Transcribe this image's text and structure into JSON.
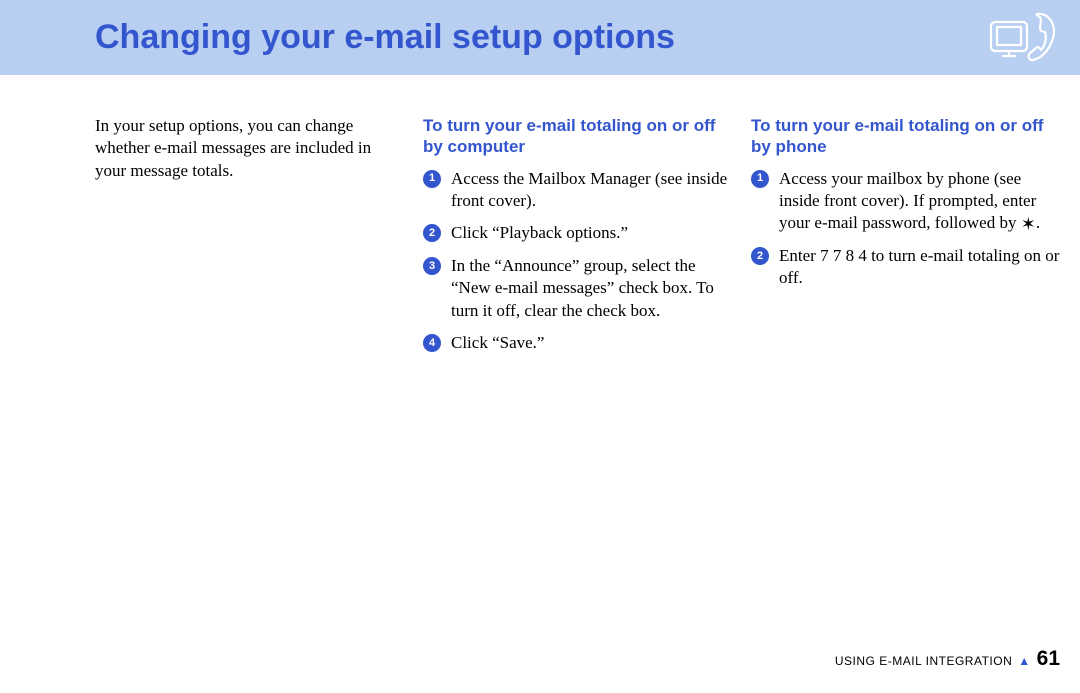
{
  "header": {
    "title": "Changing your e-mail setup options"
  },
  "intro": "In your setup options, you can change whether e-mail messages are included in your message totals.",
  "section_computer": {
    "heading": "To turn your e-mail totaling on or off by computer",
    "steps": [
      "Access the Mailbox Manager (see inside front cover).",
      "Click “Playback options.”",
      "In the “Announce” group, select the “New e-mail messages” check box. To turn it off, clear the check box.",
      "Click “Save.”"
    ]
  },
  "section_phone": {
    "heading": "To turn your e-mail totaling on or off by phone",
    "step1_before": "Access your mailbox by phone (see inside front cover). If prompted, enter your e-mail password, followed by ",
    "step1_star": "✶",
    "step1_after": ".",
    "step2": "Enter 7 7 8 4 to turn e-mail totaling on or off."
  },
  "footer": {
    "section_label": "USING E-MAIL INTEGRATION",
    "page_number": "61"
  }
}
